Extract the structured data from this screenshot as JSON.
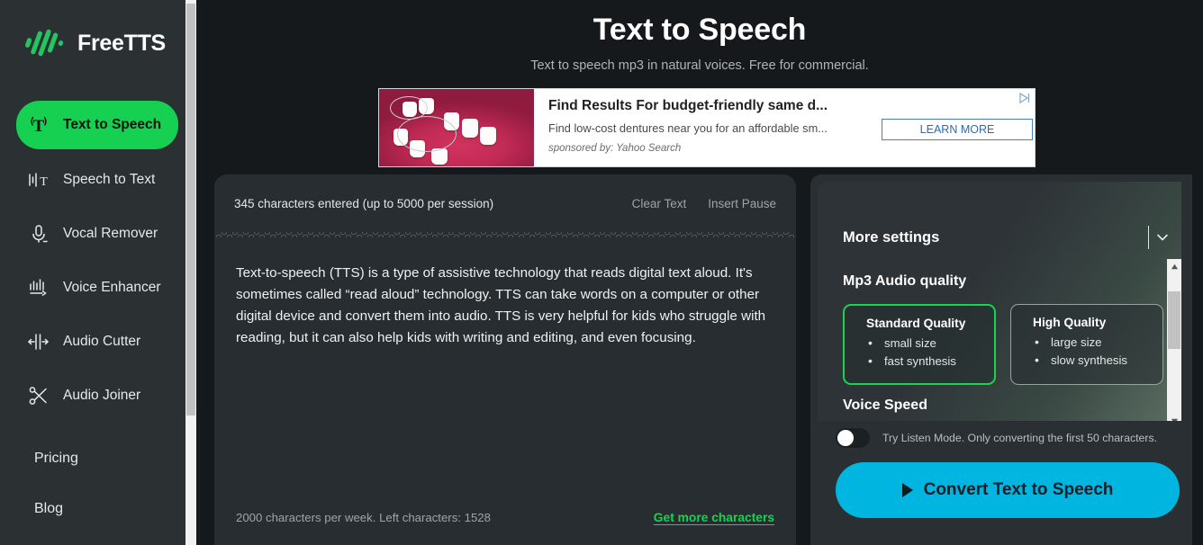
{
  "brand": {
    "name": "FreeTTS",
    "logo_icon": "waveform-slash-logo"
  },
  "sidebar": {
    "items": [
      {
        "label": "Text to Speech",
        "icon": "text-to-speech-icon",
        "active": true
      },
      {
        "label": "Speech to Text",
        "icon": "speech-to-text-icon",
        "active": false
      },
      {
        "label": "Vocal Remover",
        "icon": "microphone-icon",
        "active": false
      },
      {
        "label": "Voice Enhancer",
        "icon": "voice-enhancer-icon",
        "active": false
      },
      {
        "label": "Audio Cutter",
        "icon": "audio-cutter-icon",
        "active": false
      },
      {
        "label": "Audio Joiner",
        "icon": "scissors-icon",
        "active": false
      }
    ],
    "links": [
      {
        "label": "Pricing"
      },
      {
        "label": "Blog"
      }
    ]
  },
  "header": {
    "title": "Text to Speech",
    "subtitle": "Text to speech mp3 in natural voices. Free for commercial."
  },
  "ad": {
    "title": "Find Results For budget-friendly same d...",
    "description": "Find low-cost dentures near you for an affordable sm...",
    "sponsored": "sponsored by: Yahoo Search",
    "cta": "LEARN MORE",
    "adchoices_icon": "adchoices-icon",
    "image_alt": "dentures-photo"
  },
  "editor": {
    "char_count_label": "345 characters entered (up to 5000 per session)",
    "clear_text": "Clear Text",
    "insert_pause": "Insert Pause",
    "content": "Text-to-speech (TTS) is a type of assistive technology that reads digital text aloud. It's sometimes called “read aloud” technology. TTS can take words on a computer or other digital device and convert them into audio. TTS is very helpful for kids who struggle with reading, but it can also help kids with writing and editing, and even focusing.",
    "quota_note": "2000 characters per week. Left characters: 1528",
    "get_more": "Get more characters"
  },
  "settings": {
    "more_settings_label": "More settings",
    "collapse_icon": "chevron-down-icon",
    "audio_quality_title": "Mp3 Audio quality",
    "quality_options": [
      {
        "name": "Standard Quality",
        "features": [
          "small size",
          "fast synthesis"
        ],
        "selected": true
      },
      {
        "name": "High Quality",
        "features": [
          "large size",
          "slow synthesis"
        ],
        "selected": false
      }
    ],
    "next_section_title": "Voice Speed",
    "listen_mode_note": "Try Listen Mode. Only converting the first 50 characters.",
    "listen_mode_on": false,
    "convert_button": "Convert Text to Speech",
    "play_icon": "play-triangle-icon"
  },
  "colors": {
    "accent_green": "#16d052",
    "link_green": "#15d44f",
    "convert_blue": "#00b5df",
    "sidebar_bg": "#2b3033",
    "page_bg": "#15191c",
    "panel_bg": "#282d31"
  }
}
